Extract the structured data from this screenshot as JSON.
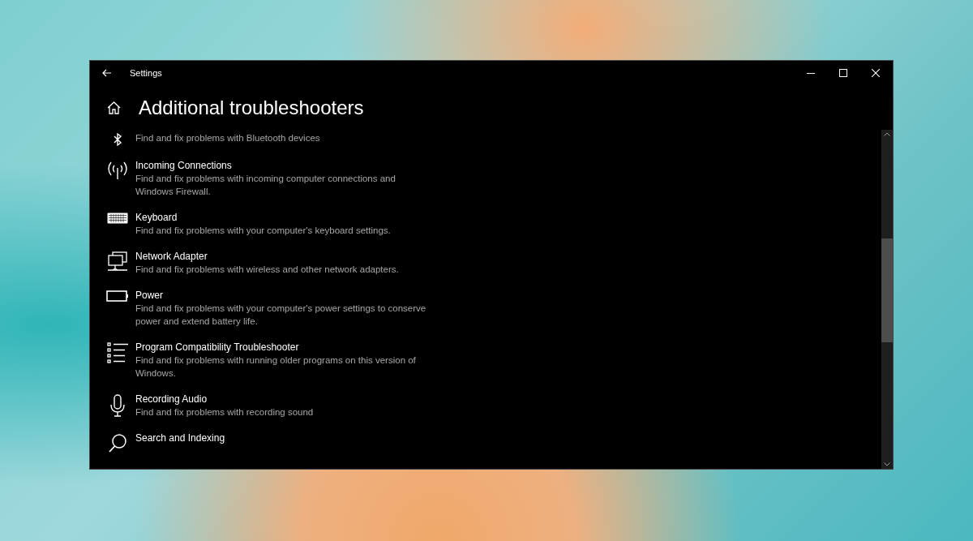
{
  "window": {
    "title": "Settings"
  },
  "page": {
    "title": "Additional troubleshooters"
  },
  "troubleshooters": [
    {
      "description": "Find and fix problems with Bluetooth devices"
    },
    {
      "title": "Incoming Connections",
      "description": "Find and fix problems with incoming computer connections and Windows Firewall."
    },
    {
      "title": "Keyboard",
      "description": "Find and fix problems with your computer's keyboard settings."
    },
    {
      "title": "Network Adapter",
      "description": "Find and fix problems with wireless and other network adapters."
    },
    {
      "title": "Power",
      "description": "Find and fix problems with your computer's power settings to conserve power and extend battery life."
    },
    {
      "title": "Program Compatibility Troubleshooter",
      "description": "Find and fix problems with running older programs on this version of Windows."
    },
    {
      "title": "Recording Audio",
      "description": "Find and fix problems with recording sound"
    },
    {
      "title": "Search and Indexing"
    }
  ]
}
